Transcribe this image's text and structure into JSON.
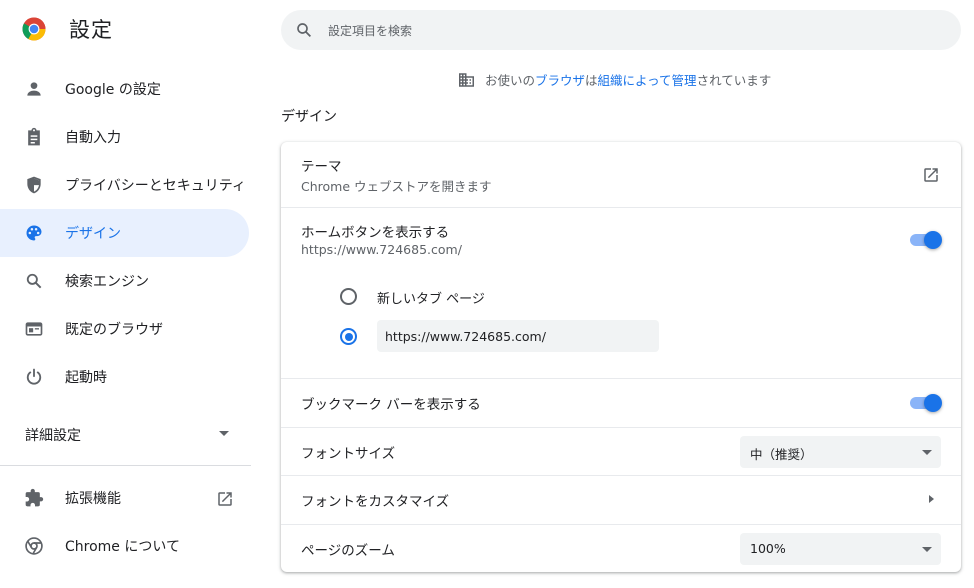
{
  "app": {
    "title": "設定"
  },
  "sidebar": {
    "items": [
      {
        "label": "Google の設定",
        "icon": "person-icon"
      },
      {
        "label": "自動入力",
        "icon": "clipboard-icon"
      },
      {
        "label": "プライバシーとセキュリティ",
        "icon": "shield-icon"
      },
      {
        "label": "デザイン",
        "icon": "palette-icon",
        "active": true
      },
      {
        "label": "検索エンジン",
        "icon": "search-icon"
      },
      {
        "label": "既定のブラウザ",
        "icon": "browser-icon"
      },
      {
        "label": "起動時",
        "icon": "power-icon"
      }
    ],
    "advanced_label": "詳細設定",
    "extensions_label": "拡張機能",
    "about_label": "Chrome について"
  },
  "search": {
    "placeholder": "設定項目を検索"
  },
  "managed": {
    "prefix": "お使いの",
    "link1": "ブラウザ",
    "middle": "は",
    "link2": "組織によって管理",
    "suffix": "されています"
  },
  "appearance": {
    "section_title": "デザイン",
    "theme": {
      "title": "テーマ",
      "subtitle": "Chrome ウェブストアを開きます"
    },
    "home_button": {
      "title": "ホームボタンを表示する",
      "subtitle": "https://www.724685.com/",
      "enabled": true,
      "options": {
        "new_tab_label": "新しいタブ ページ",
        "custom_url": "https://www.724685.com/"
      },
      "selected": "custom"
    },
    "bookmarks_bar": {
      "title": "ブックマーク バーを表示する",
      "enabled": true
    },
    "font_size": {
      "title": "フォントサイズ",
      "value": "中（推奨）"
    },
    "customize_fonts": {
      "title": "フォントをカスタマイズ"
    },
    "page_zoom": {
      "title": "ページのズーム",
      "value": "100%"
    }
  },
  "colors": {
    "accent": "#1a73e8",
    "active_bg": "#e8f0fe",
    "toggle_track": "#8ab4f8"
  }
}
